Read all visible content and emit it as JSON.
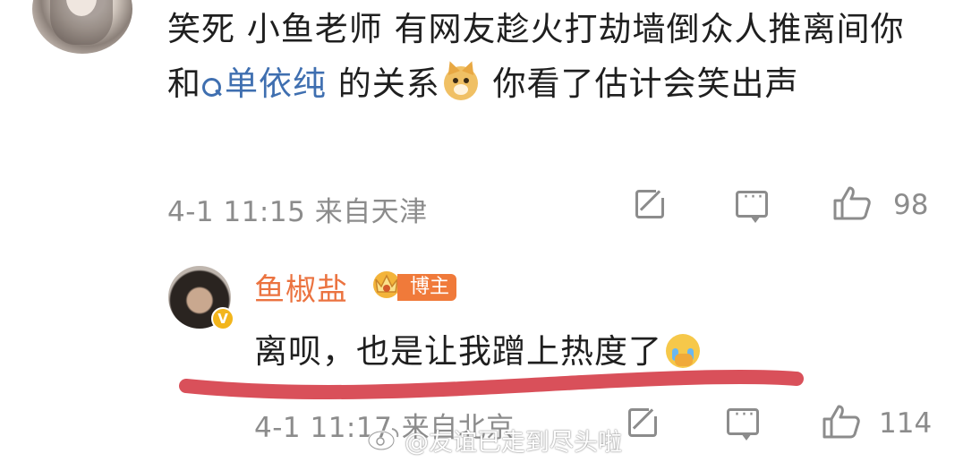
{
  "top_comment": {
    "text_before_mention": "笑死 小鱼老师 有网友趁火打劫墙倒众人推离间你和",
    "mention": "单依纯",
    "text_after_mention_1": " 的关系",
    "text_after_mention_2": " 你看了估计会笑出声",
    "timestamp": "4-1 11:15",
    "location": "来自天津",
    "like_count": "98",
    "emoji_icon": "doge-emoji"
  },
  "reply": {
    "username": "鱼椒盐",
    "role_badge": "博主",
    "text": "离呗，也是让我蹭上热度了",
    "timestamp": "4-1 11:17",
    "location": "来自北京",
    "like_count": "114",
    "verified_badge": "V",
    "emoji_icon": "crying-emoji"
  },
  "watermark": "@友谊已走到尽头啦",
  "colors": {
    "username": "#eb7340",
    "mention": "#3f6fb0",
    "meta": "#8c8c8c",
    "highlight_line": "#d9505a"
  }
}
